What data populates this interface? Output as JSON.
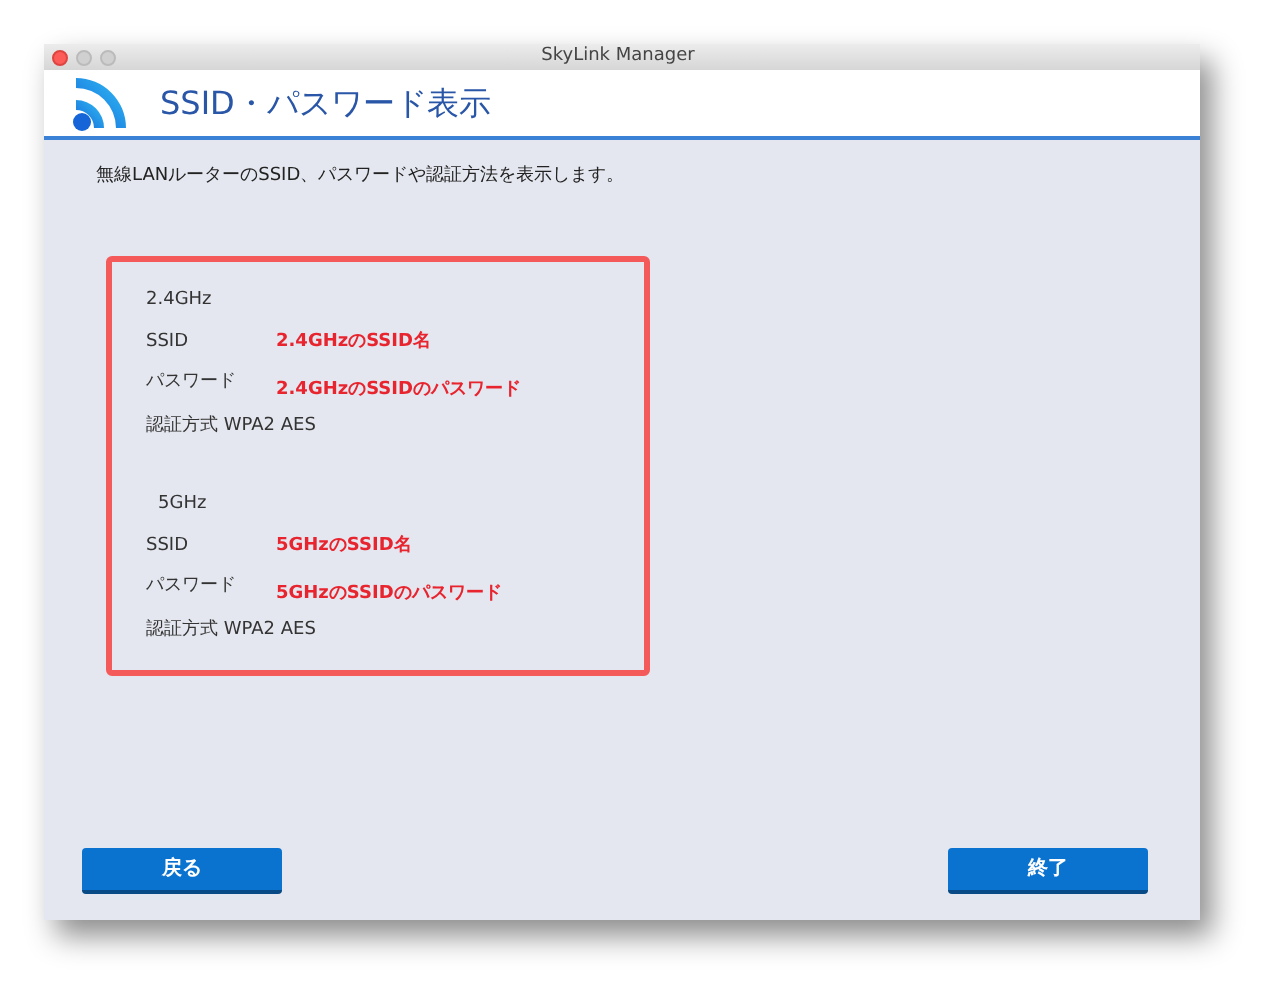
{
  "window": {
    "title": "SkyLink Manager"
  },
  "header": {
    "title": "SSID・パスワード表示"
  },
  "description": "無線LANルーターのSSID、パスワードや認証方法を表示します。",
  "bands": [
    {
      "band": "2.4GHz",
      "ssid_label": "SSID",
      "ssid": "2.4GHzのSSID名",
      "password_label": "パスワード",
      "password": "2.4GHzのSSIDのパスワード",
      "auth": "認証方式 WPA2 AES"
    },
    {
      "band": "5GHz",
      "ssid_label": "SSID",
      "ssid": "5GHzのSSID名",
      "password_label": "パスワード",
      "password": "5GHzのSSIDのパスワード",
      "auth": "認証方式 WPA2 AES"
    }
  ],
  "buttons": [
    {
      "label": "戻る"
    },
    {
      "label": "終了"
    }
  ]
}
